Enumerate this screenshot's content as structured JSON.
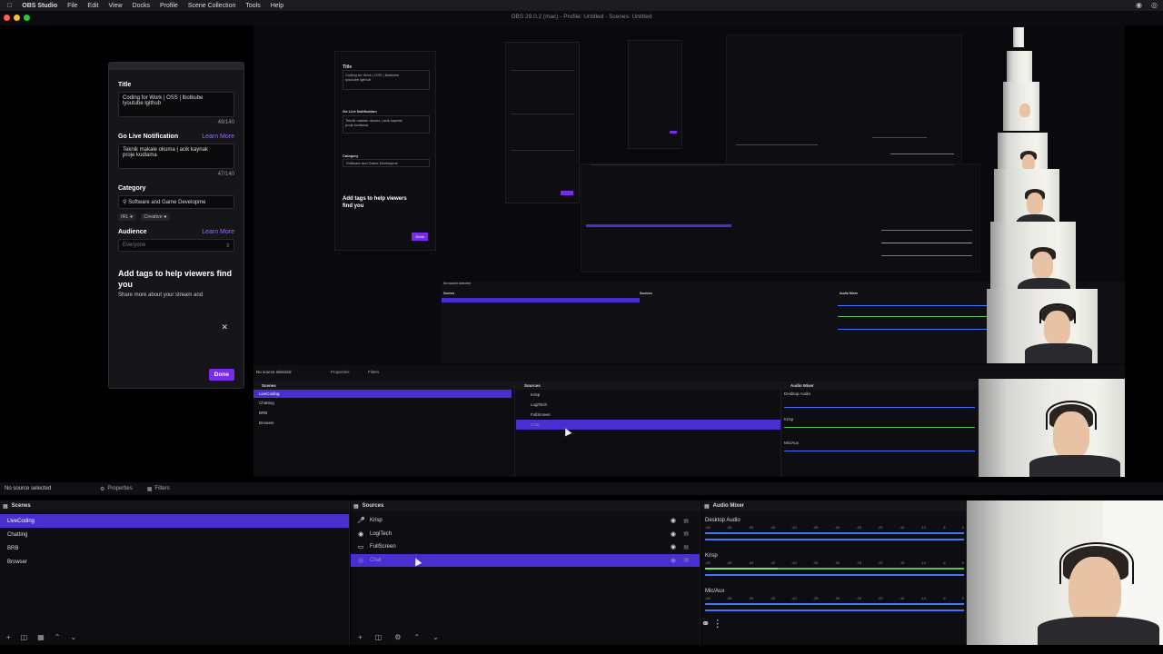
{
  "menubar": {
    "apple": "",
    "app_name": "OBS Studio",
    "items": [
      "File",
      "Edit",
      "View",
      "Docks",
      "Profile",
      "Scene Collection",
      "Tools",
      "Help"
    ]
  },
  "window": {
    "title": "OBS 29.0.2 (mac) - Profile: Untitled - Scenes: Untitled"
  },
  "stream_info": {
    "title_label": "Title",
    "title_value": "Coding for Work | OSS | lbotkube\nlyoutube lgithub",
    "title_count": "49/140",
    "notification_label": "Go Live Notification",
    "learn_more": "Learn More",
    "notification_value": "Teknik makale okuma | acik kaynak\nproje kodlama",
    "notification_count": "47/140",
    "category_label": "Category",
    "category_value": "Software and Game Developme",
    "tag_irl": "IRL",
    "tag_creative": "Creative",
    "audience_label": "Audience",
    "audience_value": "Everyone",
    "tags_heading": "Add tags to help viewers find you",
    "tags_sub": "Share more about your stream and",
    "done": "Done"
  },
  "preview_mini": {
    "no_source": "No source selected",
    "properties": "Properties",
    "filters": "Filters",
    "scenes_title": "Scenes",
    "sources_title": "Sources",
    "mixer_title": "Audio Mixer",
    "scenes": [
      "LiveCoding",
      "Chatting",
      "BRB",
      "Browser"
    ],
    "sources": [
      "Krisp",
      "LogiTech",
      "FullScreen",
      "Chat"
    ],
    "mixer": [
      "Desktop Audio",
      "Krisp",
      "Mic/Aux"
    ]
  },
  "controls": {
    "no_source": "No source selected",
    "properties": "Properties",
    "filters": "Filters"
  },
  "scenes": {
    "title": "Scenes",
    "items": [
      {
        "label": "LiveCoding",
        "selected": true
      },
      {
        "label": "Chatting",
        "selected": false
      },
      {
        "label": "BRB",
        "selected": false
      },
      {
        "label": "Browser",
        "selected": false
      }
    ]
  },
  "sources": {
    "title": "Sources",
    "items": [
      {
        "label": "Krisp",
        "icon": "microphone-icon",
        "selected": false
      },
      {
        "label": "LogiTech",
        "icon": "camera-icon",
        "selected": false
      },
      {
        "label": "FullScreen",
        "icon": "display-icon",
        "selected": false
      },
      {
        "label": "Chat",
        "icon": "globe-icon",
        "selected": true
      }
    ]
  },
  "mixer": {
    "title": "Audio Mixer",
    "ticks": [
      "-60",
      "-55",
      "-50",
      "-45",
      "-40",
      "-35",
      "-30",
      "-25",
      "-20",
      "-15",
      "-10",
      "-5",
      "0"
    ],
    "channels": [
      {
        "name": "Desktop Audio",
        "level": 0,
        "color": "#3d78ff"
      },
      {
        "name": "Krisp",
        "level": 0.28,
        "color": "#58c24f"
      },
      {
        "name": "Mic/Aux",
        "level": 0,
        "color": "#3d78ff"
      }
    ]
  },
  "colors": {
    "accent": "#4b2ecf",
    "twitch_purple": "#772ce8",
    "meter_blue": "#3d78ff",
    "meter_green": "#58c24f"
  }
}
